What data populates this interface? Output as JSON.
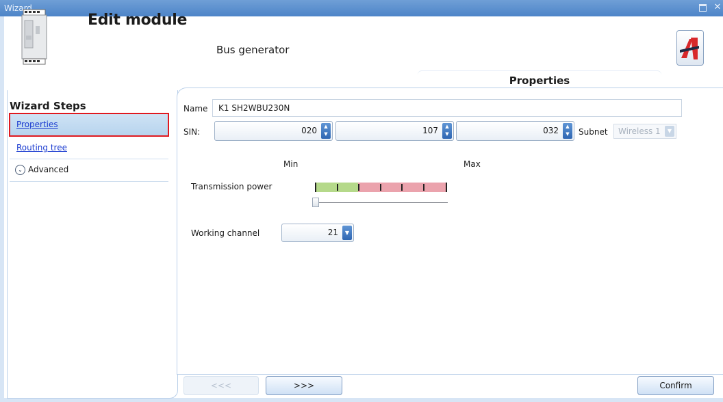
{
  "window": {
    "title": "Wizard..."
  },
  "header": {
    "title": "Edit module",
    "subtitle": "Bus generator",
    "tab_label": "Properties"
  },
  "sidebar": {
    "heading": "Wizard Steps",
    "items": [
      {
        "label": "Properties",
        "selected": true
      },
      {
        "label": "Routing tree",
        "selected": false
      },
      {
        "label": "Advanced",
        "selected": false
      }
    ]
  },
  "form": {
    "name_label": "Name",
    "name_value": "K1 SH2WBU230N",
    "sin_label": "SIN:",
    "sin_values": [
      "020",
      "107",
      "032"
    ],
    "subnet_label": "Subnet",
    "subnet_value": "Wireless 1",
    "min_label": "Min",
    "max_label": "Max",
    "power_label": "Transmission power",
    "power_level": 0,
    "channel_label": "Working channel",
    "channel_value": "21"
  },
  "nav": {
    "prev_label": "<<<",
    "next_label": ">>>",
    "confirm_label": "Confirm"
  },
  "colors": {
    "accent": "#4d84c8",
    "selection_outline": "#e0191f",
    "link": "#1a3bd0",
    "bar_green": "#b5d98a",
    "bar_red": "#eba3ad"
  }
}
